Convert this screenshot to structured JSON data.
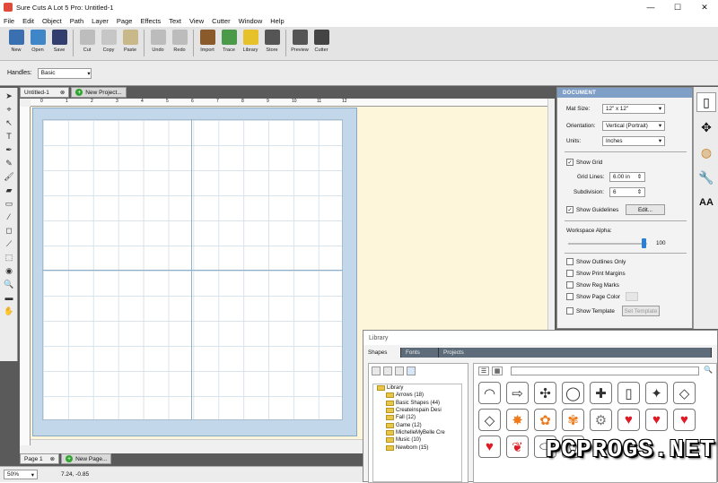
{
  "window": {
    "title": "Sure Cuts A Lot 5 Pro: Untitled-1",
    "minimize": "—",
    "maximize": "☐",
    "close": "✕"
  },
  "menu": [
    "File",
    "Edit",
    "Object",
    "Path",
    "Layer",
    "Page",
    "Effects",
    "Text",
    "View",
    "Cutter",
    "Window",
    "Help"
  ],
  "toolbar": [
    {
      "label": "New",
      "icon": "new-document-icon",
      "color": "#3a6fb0"
    },
    {
      "label": "Open",
      "icon": "open-folder-icon",
      "color": "#3f86c8"
    },
    {
      "label": "Save",
      "icon": "save-disk-icon",
      "color": "#333d6e"
    },
    {
      "label": "Cut",
      "icon": "scissors-icon",
      "color": "#bdbdbd"
    },
    {
      "label": "Copy",
      "icon": "copy-icon",
      "color": "#c6c6c6"
    },
    {
      "label": "Paste",
      "icon": "paste-clipboard-icon",
      "color": "#c9b98a"
    },
    {
      "label": "Undo",
      "icon": "undo-arrow-icon",
      "color": "#bcbcbc"
    },
    {
      "label": "Redo",
      "icon": "redo-arrow-icon",
      "color": "#bcbcbc"
    },
    {
      "label": "Import",
      "icon": "import-image-icon",
      "color": "#8a5a2a"
    },
    {
      "label": "Trace",
      "icon": "trace-image-icon",
      "color": "#4a9a4a"
    },
    {
      "label": "Library",
      "icon": "library-star-icon",
      "color": "#e7c12a"
    },
    {
      "label": "Store",
      "icon": "shopping-cart-icon",
      "color": "#555"
    },
    {
      "label": "Preview",
      "icon": "magnifier-icon",
      "color": "#555"
    },
    {
      "label": "Cutter",
      "icon": "cutter-blade-icon",
      "color": "#444"
    }
  ],
  "handles": {
    "label": "Handles:",
    "value": "Basic"
  },
  "tabs": {
    "doc": "Untitled-1",
    "new_project": "New Project...",
    "page": "Page 1",
    "new_page": "New Page..."
  },
  "ruler_ticks": [
    "0",
    "1",
    "2",
    "3",
    "4",
    "5",
    "6",
    "7",
    "8",
    "9",
    "10",
    "11",
    "12"
  ],
  "status": {
    "zoom": "50%",
    "coords": "7.24, -0.85"
  },
  "document_panel": {
    "header": "DOCUMENT",
    "mat_size_label": "Mat Size:",
    "mat_size": "12\" x 12\"",
    "orientation_label": "Orientation:",
    "orientation": "Vertical (Portrait)",
    "units_label": "Units:",
    "units": "Inches",
    "show_grid": "Show Grid",
    "grid_lines_label": "Grid Lines:",
    "grid_lines": "6.00 in",
    "subdivision_label": "Subdivision:",
    "subdivision": "6",
    "show_guidelines": "Show Guidelines",
    "edit": "Edit...",
    "workspace_alpha": "Workspace Alpha:",
    "alpha_value": "100",
    "show_outlines": "Show Outlines Only",
    "show_print_margins": "Show Print Margins",
    "show_reg_marks": "Show Reg Marks",
    "show_page_color": "Show Page Color",
    "show_template": "Show Template",
    "set_template": "Set Template"
  },
  "library": {
    "title": "Library",
    "tabs": [
      "Shapes",
      "Fonts",
      "Projects"
    ],
    "tree": [
      "Library",
      "Arrows (18)",
      "Basic Shapes (44)",
      "Createinspain Desi",
      "Fall (12)",
      "Game (12)",
      "MichelleMyBelle Cre",
      "Music (10)",
      "Newborn (15)"
    ]
  },
  "watermark": "PCPROGS.NET"
}
